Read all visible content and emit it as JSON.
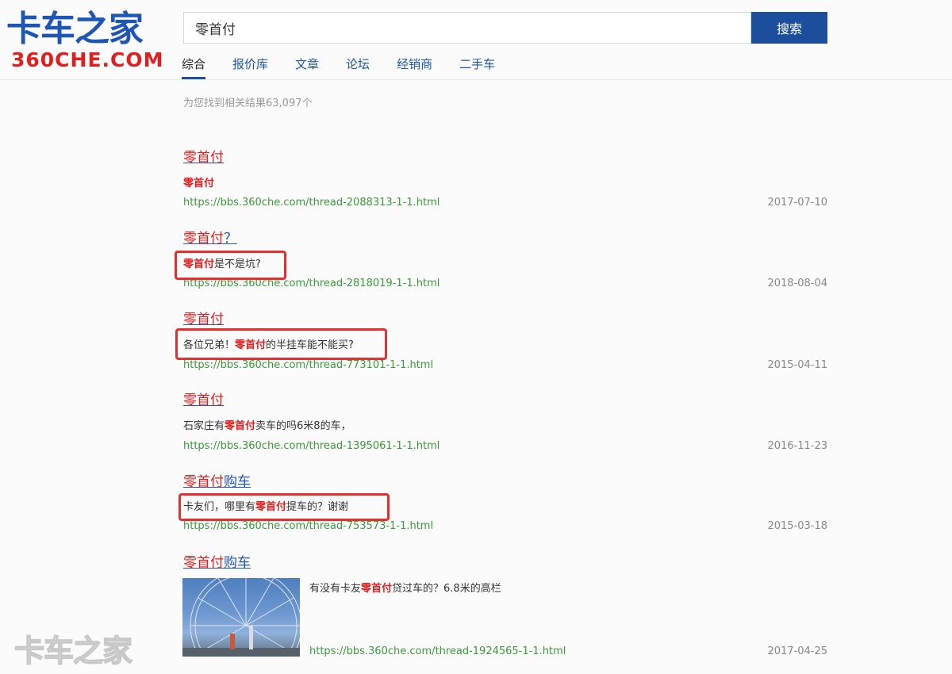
{
  "logo": {
    "cn": "卡车之家",
    "domain": "360CHE.COM"
  },
  "search": {
    "value": "零首付",
    "button": "搜索"
  },
  "tabs": [
    "综合",
    "报价库",
    "文章",
    "论坛",
    "经销商",
    "二手车"
  ],
  "result_count": "为您找到相关结果63,097个",
  "results": [
    {
      "title_hl": "零首付",
      "title_rest": "",
      "desc_pre": "",
      "desc_hl": "零首付",
      "desc_post": "",
      "url": "https://bbs.360che.com/thread-2088313-1-1.html",
      "date": "2017-07-10"
    },
    {
      "title_hl": "零首付",
      "title_rest": "？",
      "desc_pre": "",
      "desc_hl": "零首付",
      "desc_post": "是不是坑?",
      "url": "https://bbs.360che.com/thread-2818019-1-1.html",
      "date": "2018-08-04"
    },
    {
      "title_hl": "零首付",
      "title_rest": "",
      "desc_pre": "各位兄弟！",
      "desc_hl": "零首付",
      "desc_post": "的半挂车能不能买?",
      "url": "https://bbs.360che.com/thread-773101-1-1.html",
      "date": "2015-04-11"
    },
    {
      "title_hl": "零首付",
      "title_rest": "",
      "desc_pre": "石家庄有",
      "desc_hl": "零首付",
      "desc_post": "卖车的吗6米8的车，",
      "url": "https://bbs.360che.com/thread-1395061-1-1.html",
      "date": "2016-11-23"
    },
    {
      "title_hl": "零首付",
      "title_rest": "购车",
      "desc_pre": "卡友们，哪里有",
      "desc_hl": "零首付",
      "desc_post": "提车的？谢谢",
      "url": "https://bbs.360che.com/thread-753573-1-1.html",
      "date": "2015-03-18"
    },
    {
      "title_hl": "零首付",
      "title_rest": "购车",
      "desc_pre": "有没有卡友",
      "desc_hl": "零首付",
      "desc_post": "贷过车的？6.8米的高栏",
      "url": "https://bbs.360che.com/thread-1924565-1-1.html",
      "date": "2017-04-25"
    }
  ],
  "watermark": "卡车之家",
  "colors": {
    "brand_blue": "#1b4f9e",
    "highlight_red": "#e02020",
    "url_green": "#3a9a3a",
    "annotation_red": "#e5302f"
  }
}
